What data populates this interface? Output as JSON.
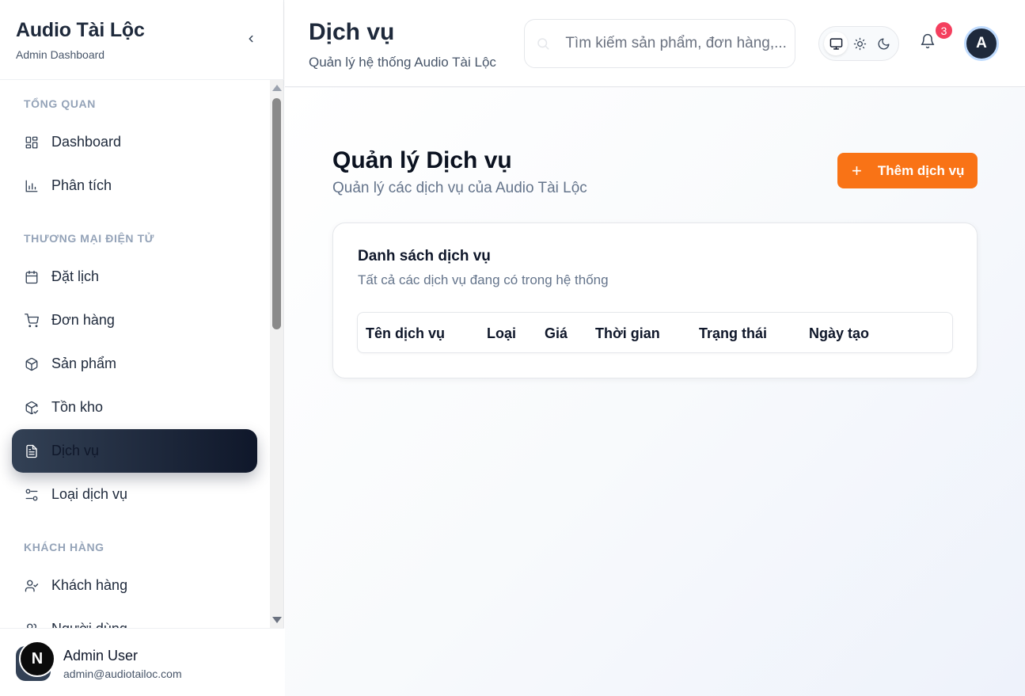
{
  "sidebar": {
    "brand_title": "Audio Tài Lộc",
    "brand_subtitle": "Admin Dashboard",
    "sections": [
      {
        "title": "TỔNG QUAN"
      },
      {
        "title": "THƯƠNG MẠI ĐIỆN TỬ"
      },
      {
        "title": "KHÁCH HÀNG"
      }
    ],
    "items": [
      {
        "label": "Dashboard",
        "icon": "dashboard-grid-icon"
      },
      {
        "label": "Phân tích",
        "icon": "bar-chart-icon"
      },
      {
        "label": "Đặt lịch",
        "icon": "calendar-icon"
      },
      {
        "label": "Đơn hàng",
        "icon": "cart-icon"
      },
      {
        "label": "Sản phẩm",
        "icon": "box-icon"
      },
      {
        "label": "Tồn kho",
        "icon": "package-check-icon"
      },
      {
        "label": "Dịch vụ",
        "icon": "file-text-icon",
        "active": true
      },
      {
        "label": "Loại dịch vụ",
        "icon": "sliders-icon"
      },
      {
        "label": "Khách hàng",
        "icon": "user-check-icon"
      },
      {
        "label": "Người dùng",
        "icon": "users-icon"
      }
    ],
    "user": {
      "initial": "N",
      "name": "Admin User",
      "email": "admin@audiotailoc.com"
    }
  },
  "header": {
    "title": "Dịch vụ",
    "subtitle": "Quản lý hệ thống Audio Tài Lộc",
    "search_placeholder": "Tìm kiếm sản phẩm, đơn hàng,...",
    "notification_count": "3",
    "avatar_initial": "A"
  },
  "main": {
    "title": "Quản lý Dịch vụ",
    "subtitle": "Quản lý các dịch vụ của Audio Tài Lộc",
    "add_button_label": "Thêm dịch vụ",
    "card": {
      "title": "Danh sách dịch vụ",
      "subtitle": "Tất cả các dịch vụ đang có trong hệ thống",
      "columns": [
        "Tên dịch vụ",
        "Loại",
        "Giá",
        "Thời gian",
        "Trạng thái",
        "Ngày tạo"
      ]
    }
  },
  "colors": {
    "accent": "#f97316",
    "active_nav": "#1e293b",
    "badge": "#f43f5e"
  }
}
